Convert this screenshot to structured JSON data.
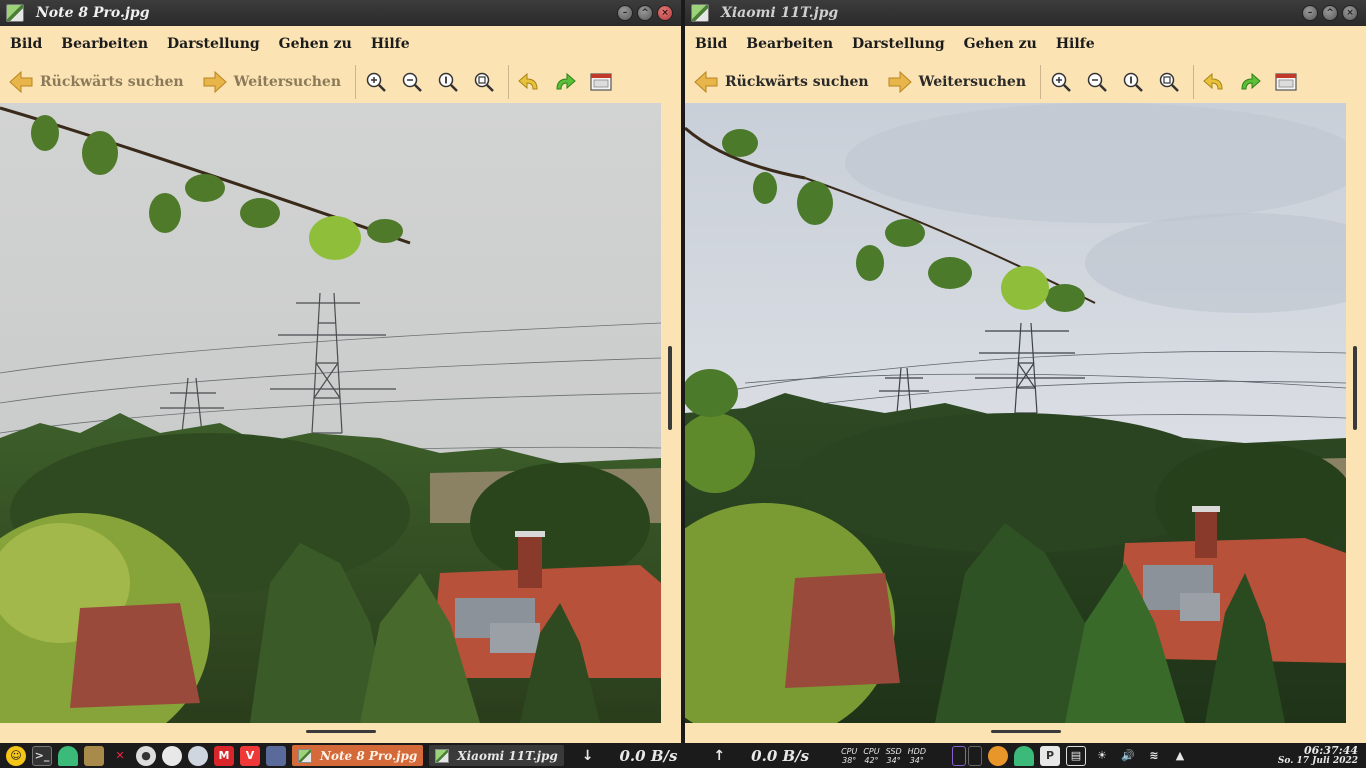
{
  "windows": [
    {
      "title": "Note 8 Pro.jpg",
      "menu": [
        "Bild",
        "Bearbeiten",
        "Darstellung",
        "Gehen zu",
        "Hilfe"
      ],
      "toolbar": {
        "back_label": "Rückwärts suchen",
        "forward_label": "Weitersuchen"
      }
    },
    {
      "title": "Xiaomi 11T.jpg",
      "menu": [
        "Bild",
        "Bearbeiten",
        "Darstellung",
        "Gehen zu",
        "Hilfe"
      ],
      "toolbar": {
        "back_label": "Rückwärts suchen",
        "forward_label": "Weitersuchen"
      }
    }
  ],
  "taskbar": {
    "tasks": [
      "Note 8 Pro.jpg",
      "Xiaomi 11T.jpg"
    ],
    "net_down": "0.0 B/s",
    "net_up": "0.0 B/s",
    "sensors": [
      {
        "label": "CPU",
        "value": "38°"
      },
      {
        "label": "CPU",
        "value": "42°"
      },
      {
        "label": "SSD",
        "value": "34°"
      },
      {
        "label": "HDD",
        "value": "34°"
      }
    ],
    "time": "06:37:44",
    "date": "So. 17 Juli 2022"
  },
  "colors": {
    "window_bg": "#fbe3b3",
    "active_task": "#d46a3a",
    "taskbar_bg": "#1b1b1b"
  }
}
